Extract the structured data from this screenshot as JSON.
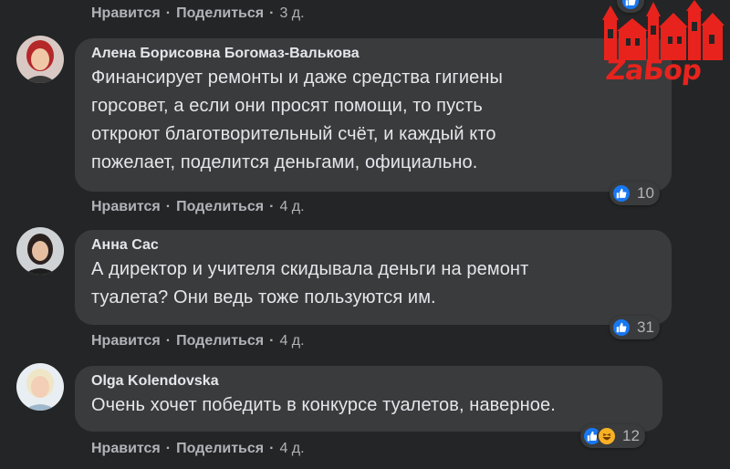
{
  "actions": {
    "like": "Нравится",
    "share": "Поделиться",
    "separator": "·"
  },
  "top_row": {
    "time": "3 д."
  },
  "comments": [
    {
      "author": "Алена Борисовна Богомаз-Валькова",
      "lines": [
        "Финансирует ремонты и даже средства гигиены",
        "горсовет, а если они просят помощи, то пусть",
        "откроют благотворительный счёт, и каждый кто",
        "пожелает, поделится деньгами, официально."
      ],
      "reactions": [
        "like"
      ],
      "reaction_count": "10",
      "time": "4 д."
    },
    {
      "author": "Анна Сас",
      "lines": [
        "А директор и учителя скидывала деньги на ремонт",
        "туалета? Они ведь тоже пользуются им."
      ],
      "reactions": [
        "like"
      ],
      "reaction_count": "31",
      "time": "4 д."
    },
    {
      "author": "Olga Kolendovska",
      "lines": [
        "Очень хочет победить в конкурсе туалетов, наверное."
      ],
      "reactions": [
        "like",
        "haha"
      ],
      "reaction_count": "12",
      "time": "4 д."
    }
  ],
  "watermark": {
    "text": "ZaБор",
    "color": "#e8231d"
  },
  "colors": {
    "background": "#242526",
    "bubble": "#3a3b3c",
    "like_blue": "#1877f2",
    "haha_yellow": "#f7b125",
    "secondary_text": "#b0b3b8"
  }
}
